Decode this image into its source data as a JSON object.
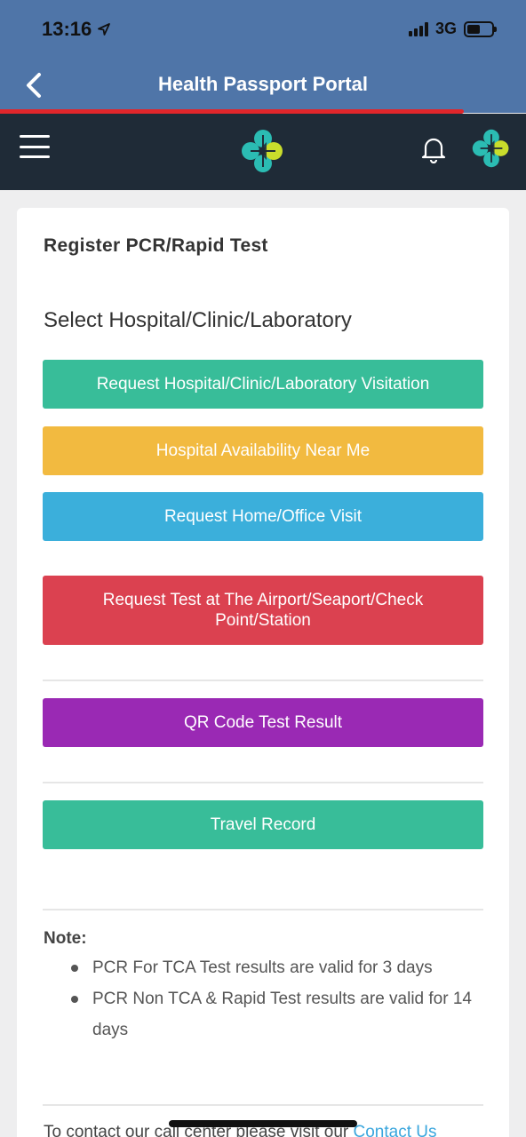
{
  "status_bar": {
    "time": "13:16",
    "network": "3G",
    "icons": [
      "location-arrow-icon",
      "signal-icon",
      "battery-icon"
    ]
  },
  "nav": {
    "title": "Health Passport Portal",
    "back_icon": "chevron-left-icon"
  },
  "app_bar": {
    "menu_icon": "hamburger-menu-icon",
    "logo_icon": "health-logo-icon",
    "bell_icon": "bell-icon"
  },
  "card": {
    "title": "Register PCR/Rapid Test",
    "section_heading": "Select Hospital/Clinic/Laboratory",
    "buttons": [
      {
        "label": "Request Hospital/Clinic/Laboratory Visitation",
        "color": "#38bd99"
      },
      {
        "label": "Hospital Availability Near Me",
        "color": "#f2ba40"
      },
      {
        "label": "Request Home/Office Visit",
        "color": "#3bafdb"
      },
      {
        "label": "Request Test at The Airport/Seaport/Check Point/Station",
        "color": "#db4150"
      },
      {
        "label": "QR Code Test Result",
        "color": "#9a29b4"
      },
      {
        "label": "Travel Record",
        "color": "#38bd99"
      }
    ],
    "note": {
      "label": "Note:",
      "items": [
        "PCR For TCA Test results are valid for 3 days",
        "PCR Non TCA & Rapid Test results are valid for 14 days"
      ]
    },
    "contact": {
      "text": "To contact our call center please visit our ",
      "link": "Contact Us"
    }
  },
  "colors": {
    "header_blue": "#4f75a8",
    "app_bar_dark": "#1f2b37",
    "progress_red": "#e0262b",
    "link_blue": "#3aa6dd"
  }
}
